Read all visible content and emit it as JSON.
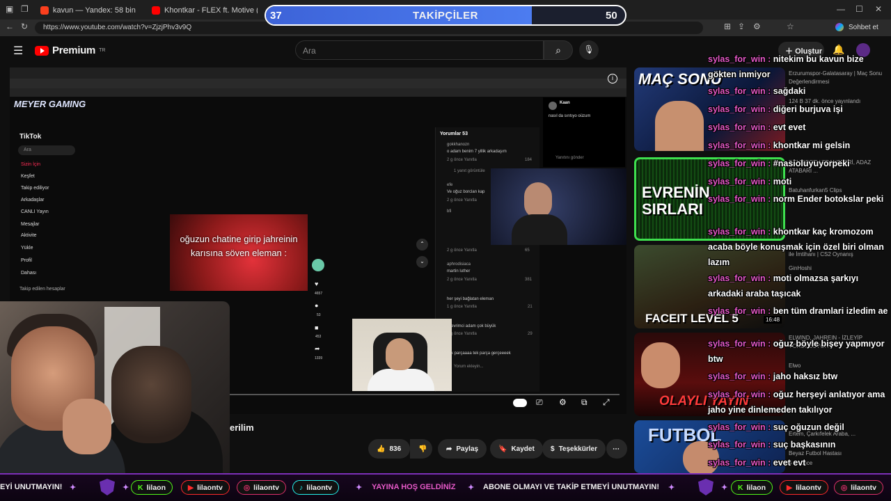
{
  "browser": {
    "tabs": [
      {
        "title": "kavun — Yandex: 58 bin sonuç bu",
        "active": false
      },
      {
        "title": "Khontkar - FLEX ft. Motive (prod. b",
        "active": false
      },
      {
        "title": "",
        "active": true
      }
    ],
    "url": "https://www.youtube.com/watch?v=ZjzjPhv3v9Q",
    "profile_label": "Sohbet et"
  },
  "youtube": {
    "logo_text": "Premium",
    "logo_region": "TR",
    "search_placeholder": "Ara",
    "create_label": "Oluştur",
    "video_title": "erilim",
    "likes": "836",
    "share_label": "Paylaş",
    "save_label": "Kaydet",
    "thanks_label": "Teşekkürler"
  },
  "follower_goal": {
    "title": "TAKİPÇİLER",
    "current": "37",
    "goal": "50",
    "progress": 0.74
  },
  "inner_screen": {
    "tiktok_logo": "TikTok",
    "search": "Ara",
    "menu": [
      "Sizin İçin",
      "Keşfet",
      "Takip ediliyor",
      "Arkadaşlar",
      "CANLI Yayın",
      "Mesajlar",
      "Aktivite",
      "Yükle",
      "Profil",
      "Dahası"
    ],
    "following_label": "Takip edilen hesaplar",
    "caption": "oğuzun chatine girip jahreinin karısına söven eleman :",
    "comments_title": "Yorumlar",
    "comments_count": "53",
    "comments": [
      {
        "user": "gokkhanozn",
        "text": "o adam benim 7 yillik arkadaşım",
        "meta": "2 g önce   Yanıtla",
        "likes": "184"
      },
      {
        "user": "efe",
        "text": "Ve oğuz borclan kap",
        "meta": "2 g önce   Yanıtla",
        "likes": ""
      },
      {
        "user": "bfi",
        "text": "",
        "meta": "2 g önce   Yanıtla",
        "likes": "65"
      },
      {
        "user": "aphrodisiaca",
        "text": "martin luther",
        "meta": "2 g önce   Yanıtla",
        "likes": "381"
      },
      {
        "user": "",
        "text": "her şeyi bağlatan eleman",
        "meta": "1 g önce   Yanıtla",
        "likes": "21"
      },
      {
        "user": "",
        "text": "evrimci adam çok büyük",
        "meta": "2 g önce   Yanıtla",
        "likes": "29"
      },
      {
        "user": "",
        "text": "k parçaaaa tek parça gerçeeeek",
        "meta": "",
        "likes": ""
      }
    ],
    "replies_label": "1 yanıt görüntüle",
    "comment_placeholder": "Yorum ekleyin...",
    "tiktok_counts": [
      "4657",
      "53",
      "453",
      "1339"
    ],
    "x_user": "Kaan",
    "x_text": "nasıl da sırıtıyo oüzum",
    "x_reply": "Yanıtını gönder",
    "meyer_logo": "MEYER GAMING"
  },
  "sidebar": {
    "videos": [
      {
        "thumb_text": "MAÇ SONU",
        "title": "Erzurumspor-Galatasaray | Maç Sonu Değerlendirmesi",
        "meta": "124 B  37 dk. önce yayınlandı"
      },
      {
        "thumb_text": "EVRENİN SIRLARI",
        "title": "DEMODETV TRANSFERİ, ADAZ ATABARI ...",
        "meta": "Batuhanfurkan5 Clips"
      },
      {
        "thumb_text": "FACEIT LEVEL 5",
        "title": "ile İmtihanı | CS2 Oynanış",
        "meta": "GinHoshi",
        "duration": "16:48"
      },
      {
        "thumb_text": "OLAYLI YAYIN",
        "title": "ELWIND, JAHREIN - İZLEYİP YORUMLUYOR",
        "meta": "Elwo"
      },
      {
        "thumb_text": "FUTBOL",
        "title": "Ertem, Çarkıfelek Araba, ...",
        "meta": "Beyaz Futbol Hastası",
        "duration": "4 yıl önce"
      }
    ]
  },
  "chat": [
    {
      "user": "sylas_for_win",
      "text": "nitekim bu kavun bize gökten inmiyor"
    },
    {
      "user": "sylas_for_win",
      "text": "sağdaki"
    },
    {
      "user": "sylas_for_win",
      "text": "diğeri burjuva işi"
    },
    {
      "user": "sylas_for_win",
      "text": "evt evet"
    },
    {
      "user": "sylas_for_win",
      "text": "khontkar mi gelsin"
    },
    {
      "user": "sylas_for_win",
      "text": "#nasioluyuyorpeki"
    },
    {
      "user": "sylas_for_win",
      "text": "moti"
    },
    {
      "user": "sylas_for_win",
      "text": "norm Ender botokslar peki"
    },
    {
      "user": "sylas_for_win",
      "text": "khontkar kaç kromozom acaba böyle konuşmak için özel biri olman lazım"
    },
    {
      "user": "sylas_for_win",
      "text": "moti olmazsa şarkıyı arkadaki araba taşıcak"
    },
    {
      "user": "sylas_for_win",
      "text": "ben tüm dramlari izledim ae"
    },
    {
      "user": "sylas_for_win",
      "text": "oğuz böyle bişey yapmıyor btw"
    },
    {
      "user": "sylas_for_win",
      "text": "jaho haksız btw"
    },
    {
      "user": "sylas_for_win",
      "text": "oğuz herşeyi anlatıyor ama jaho yine dinlemeden takılıyor"
    },
    {
      "user": "sylas_for_win",
      "text": "suç oğuzun değil"
    },
    {
      "user": "sylas_for_win",
      "text": "suç başkasının"
    },
    {
      "user": "sylas_for_win",
      "text": "evet evt"
    }
  ],
  "ticker": {
    "left_text": "EYİ UNUTMAYIN!",
    "kick": "lilaon",
    "youtube": "lilaontv",
    "instagram": "lilaontv",
    "tiktok": "lilaontv",
    "welcome": "YAYINA HOŞ GELDİNİZ",
    "follow_text": "ABONE OLMAYI VE TAKİP ETMEYİ UNUTMAYIN!"
  },
  "colors": {
    "accent_pink": "#e659c8",
    "ticker_purple": "#7d2fb8",
    "yt_red": "#ff0000",
    "goal_blue": "#4c7cf0"
  }
}
